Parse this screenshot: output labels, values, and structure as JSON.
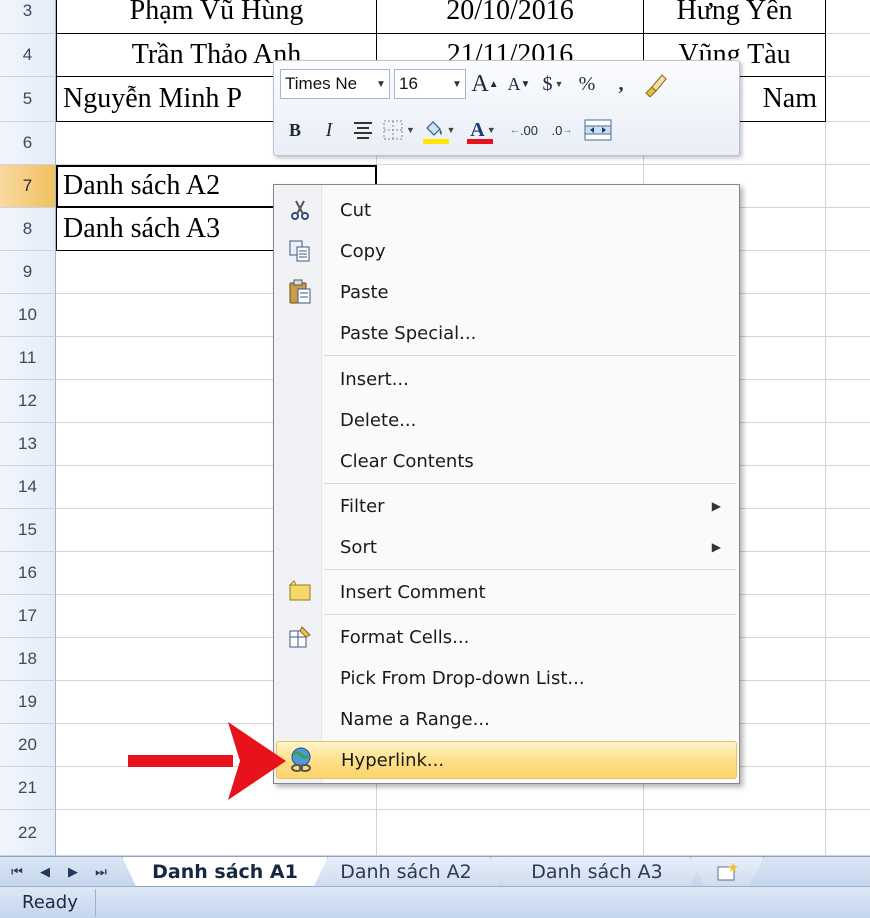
{
  "sheet": {
    "rows": [
      {
        "num": "3",
        "c1": "Phạm Vũ Hùng",
        "c2": "20/10/2016",
        "c3": "Hưng Yên"
      },
      {
        "num": "4",
        "c1": "Trần Thảo Anh",
        "c2": "21/11/2016",
        "c3": "Vũng Tàu"
      },
      {
        "num": "5",
        "c1": "Nguyễn Minh P",
        "c2": "",
        "c3": "Nam"
      },
      {
        "num": "6",
        "c1": "",
        "c2": "",
        "c3": ""
      },
      {
        "num": "7",
        "c1": "Danh sách A2",
        "c2": "",
        "c3": ""
      },
      {
        "num": "8",
        "c1": "Danh sách A3",
        "c2": "",
        "c3": ""
      },
      {
        "num": "9"
      },
      {
        "num": "10"
      },
      {
        "num": "11"
      },
      {
        "num": "12"
      },
      {
        "num": "13"
      },
      {
        "num": "14"
      },
      {
        "num": "15"
      },
      {
        "num": "16"
      },
      {
        "num": "17"
      },
      {
        "num": "18"
      },
      {
        "num": "19"
      },
      {
        "num": "20"
      },
      {
        "num": "21"
      },
      {
        "num": "22"
      }
    ]
  },
  "minibar": {
    "font_name": "Times Ne",
    "font_size": "16",
    "grow_font": "A",
    "shrink_font": "A",
    "currency": "$",
    "percent": "%",
    "comma": ",",
    "bold": "B",
    "italic": "I",
    "font_color_letter": "A",
    "inc_decimal": ".00",
    "dec_decimal": ".0"
  },
  "context_menu": {
    "items": [
      {
        "label": "Cut",
        "icon": "scissors-icon"
      },
      {
        "label": "Copy",
        "icon": "copy-icon"
      },
      {
        "label": "Paste",
        "icon": "paste-icon"
      },
      {
        "label": "Paste Special...",
        "icon": ""
      },
      {
        "label": "Insert...",
        "icon": ""
      },
      {
        "label": "Delete...",
        "icon": ""
      },
      {
        "label": "Clear Contents",
        "icon": ""
      },
      {
        "label": "Filter",
        "icon": "",
        "submenu": true
      },
      {
        "label": "Sort",
        "icon": "",
        "submenu": true
      },
      {
        "label": "Insert Comment",
        "icon": "comment-icon"
      },
      {
        "label": "Format Cells...",
        "icon": "format-cells-icon"
      },
      {
        "label": "Pick From Drop-down List...",
        "icon": ""
      },
      {
        "label": "Name a Range...",
        "icon": ""
      },
      {
        "label": "Hyperlink...",
        "icon": "hyperlink-globe-icon",
        "highlighted": true
      }
    ]
  },
  "tabs": {
    "sheets": [
      "Danh sách A1",
      "Danh sách A2",
      "Danh sách A3"
    ],
    "active": "Danh sách A1"
  },
  "status": {
    "text": "Ready"
  },
  "colors": {
    "arrow": "#e8121d",
    "highlight": "#fde088",
    "selected_row_header": "#f1c15f"
  }
}
